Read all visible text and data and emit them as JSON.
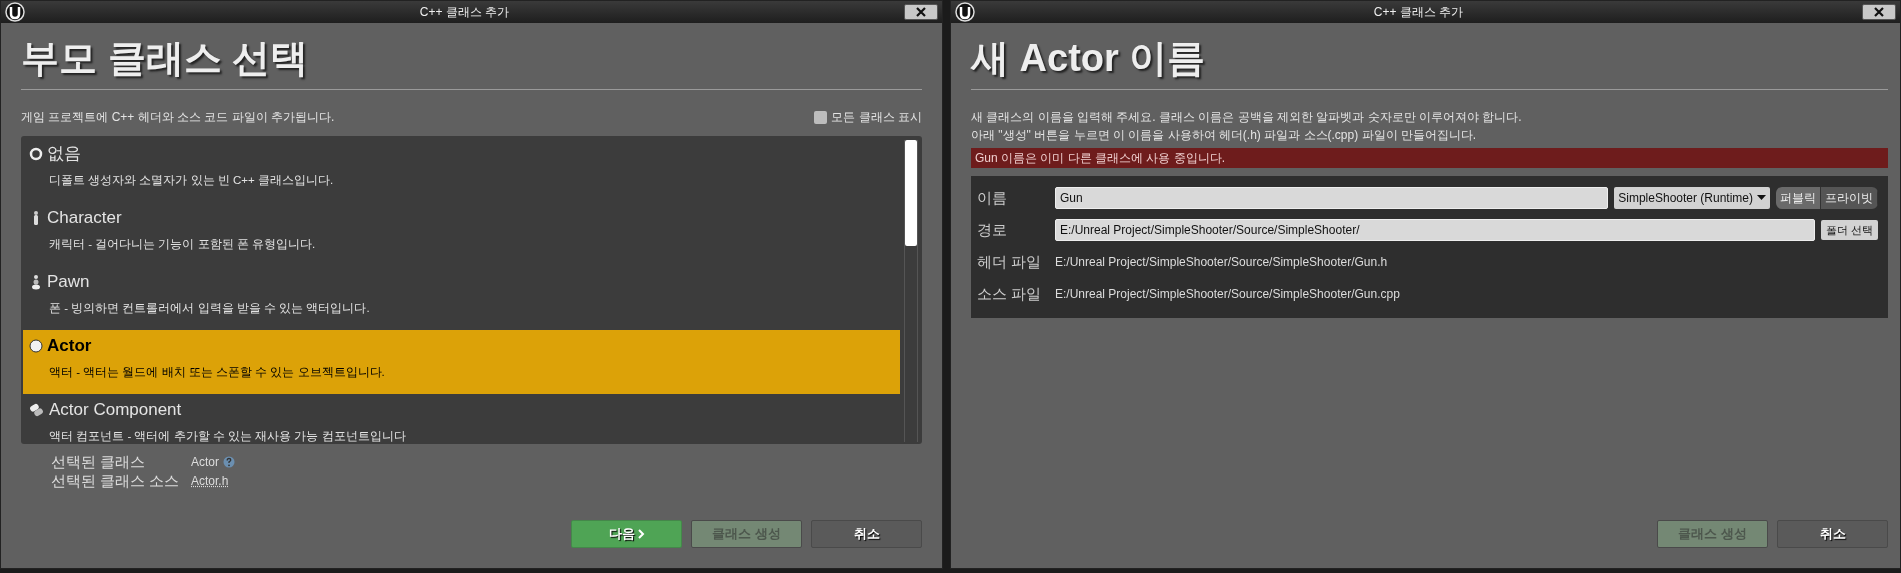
{
  "parent_class_window": {
    "title": "C++ 클래스 추가",
    "heading": "부모 클래스 선택",
    "description": "게임 프로젝트에 C++ 헤더와 소스 코드 파일이 추가됩니다.",
    "show_all_classes": {
      "label": "모든 클래스 표시",
      "checked": false
    },
    "classes": [
      {
        "kind": "none",
        "name": "없음",
        "description": "디폴트 생성자와 소멸자가 있는 빈 C++ 클래스입니다.",
        "selected": false
      },
      {
        "kind": "character",
        "name": "Character",
        "description": "캐릭터 - 걸어다니는 기능이 포함된 폰 유형입니다.",
        "selected": false
      },
      {
        "kind": "pawn",
        "name": "Pawn",
        "description": "폰 - 빙의하면 컨트롤러에서 입력을 받을 수 있는 액터입니다.",
        "selected": false
      },
      {
        "kind": "actor",
        "name": "Actor",
        "description": "액터 - 액터는 월드에 배치 또는 스폰할 수 있는 오브젝트입니다.",
        "selected": true
      },
      {
        "kind": "component",
        "name": "Actor Component",
        "description": "액터 컴포넌트 - 액터에 추가할 수 있는 재사용 가능 컴포넌트입니다",
        "selected": false
      }
    ],
    "selected_class": {
      "label": "선택된 클래스",
      "value": "Actor"
    },
    "selected_class_source": {
      "label": "선택된 클래스 소스",
      "value": "Actor.h"
    },
    "buttons": [
      {
        "kind": "next",
        "label": "다음",
        "disabled": false
      },
      {
        "kind": "create",
        "label": "클래스 생성",
        "disabled": true
      },
      {
        "kind": "cancel",
        "label": "취소",
        "disabled": false
      }
    ]
  },
  "name_window": {
    "title": "C++ 클래스 추가",
    "heading": "새 Actor 이름",
    "description_lines": [
      "새 클래스의 이름을 입력해 주세요. 클래스 이름은 공백을 제외한 알파벳과 숫자로만 이루어져야 합니다.",
      "아래 \"생성\" 버튼을 누르면 이 이름을 사용하여 헤더(.h) 파일과 소스(.cpp) 파일이 만들어집니다."
    ],
    "error": "Gun 이름은 이미 다른 클래스에 사용 중입니다.",
    "name_field": {
      "label": "이름",
      "value": "Gun"
    },
    "module_dropdown": "SimpleShooter (Runtime)",
    "visibility": [
      {
        "label": "퍼블릭",
        "selected": true
      },
      {
        "label": "프라이빗",
        "selected": false
      }
    ],
    "path_field": {
      "label": "경로",
      "value": "E:/Unreal Project/SimpleShooter/Source/SimpleShooter/"
    },
    "folder_button": "폴더 선택",
    "header_file": {
      "label": "헤더 파일",
      "value": "E:/Unreal Project/SimpleShooter/Source/SimpleShooter/Gun.h"
    },
    "source_file": {
      "label": "소스 파일",
      "value": "E:/Unreal Project/SimpleShooter/Source/SimpleShooter/Gun.cpp"
    },
    "buttons": [
      {
        "kind": "create",
        "label": "클래스 생성",
        "disabled": true
      },
      {
        "kind": "cancel",
        "label": "취소",
        "disabled": false
      }
    ]
  }
}
